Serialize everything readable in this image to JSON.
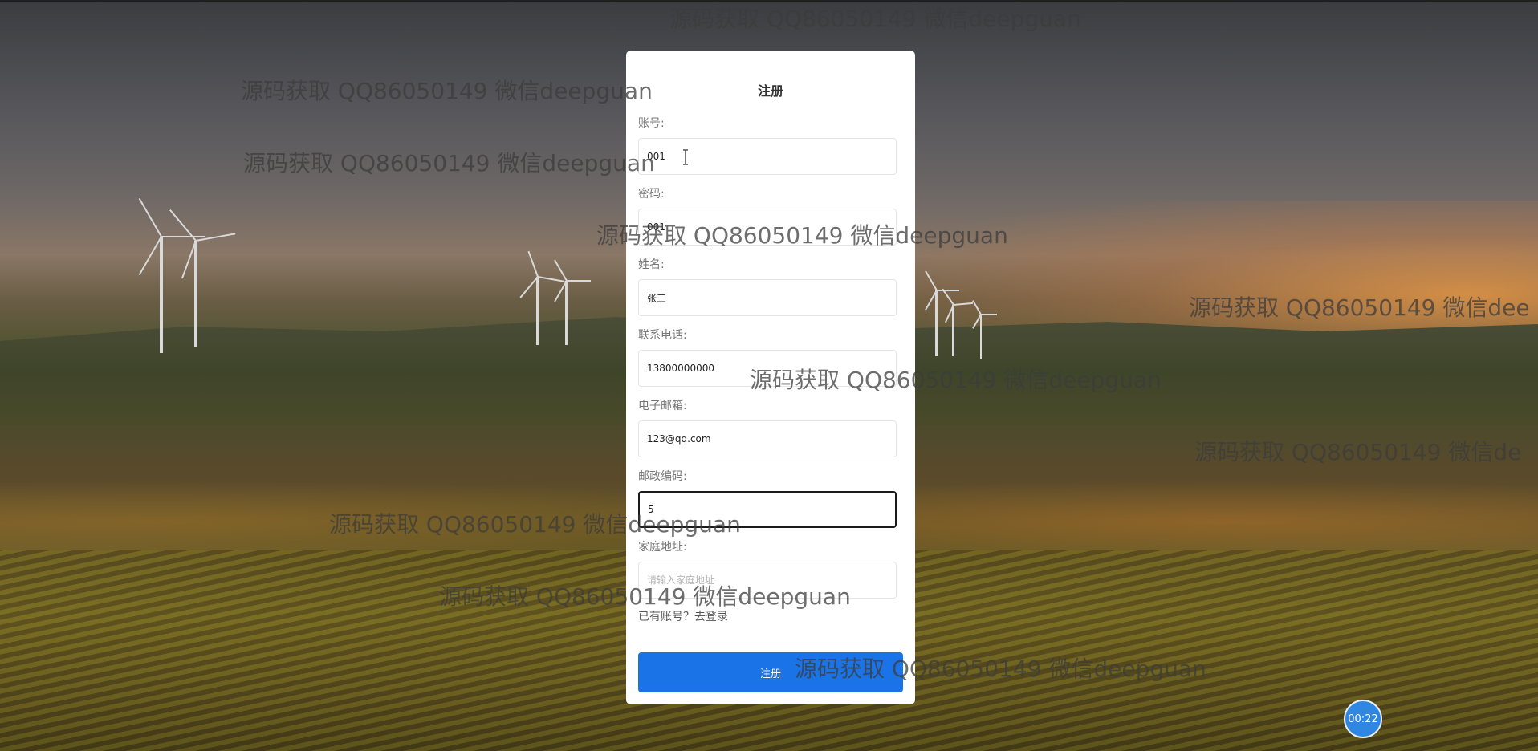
{
  "form": {
    "title": "注册",
    "fields": [
      {
        "label": "账号:",
        "value": "001",
        "placeholder": ""
      },
      {
        "label": "密码:",
        "value": "001",
        "placeholder": ""
      },
      {
        "label": "姓名:",
        "value": "张三",
        "placeholder": ""
      },
      {
        "label": "联系电话:",
        "value": "13800000000",
        "placeholder": ""
      },
      {
        "label": "电子邮箱:",
        "value": "123@qq.com",
        "placeholder": ""
      },
      {
        "label": "邮政编码:",
        "value": "5",
        "placeholder": ""
      },
      {
        "label": "家庭地址:",
        "value": "",
        "placeholder": "请输入家庭地址"
      }
    ],
    "login_link": "已有账号？去登录",
    "submit_label": "注册"
  },
  "timer": {
    "label": "00:22",
    "color": "#2f87e2"
  },
  "accent_color": "#1b73e8",
  "watermark_text": "源码获取 QQ86050149 微信deepguan",
  "watermark_text_cut1": "源码获取 QQ86050149 微信dee",
  "watermark_text_cut2": "源码获取 QQ86050149 微信de"
}
